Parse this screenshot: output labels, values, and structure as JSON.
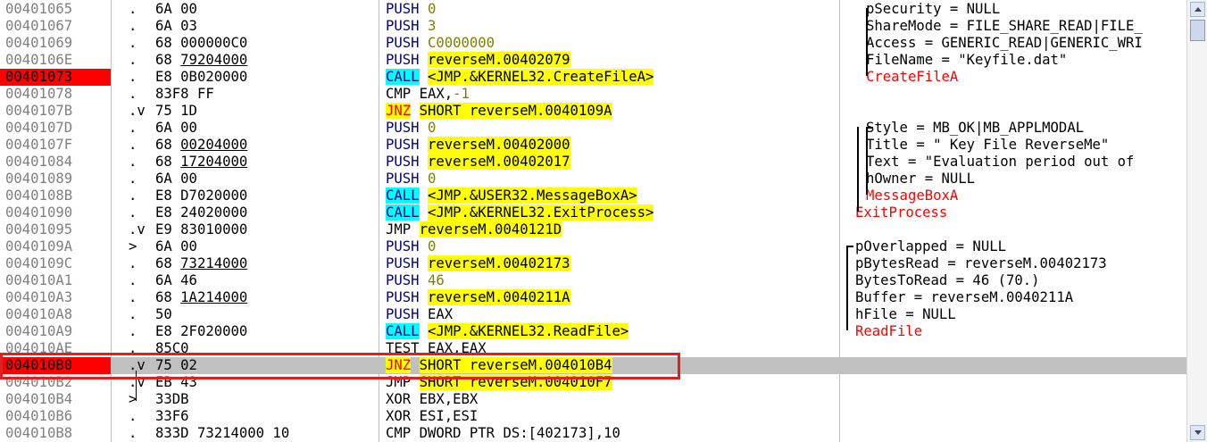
{
  "rows": [
    {
      "addr": "00401065",
      "mark": ".",
      "hex": [
        "6A 00"
      ],
      "mn": "PUSH",
      "op": "0",
      "cmt": "pSecurity = NULL"
    },
    {
      "addr": "00401067",
      "mark": ".",
      "hex": [
        "6A 03"
      ],
      "mn": "PUSH",
      "op": "3",
      "cmt": "ShareMode = FILE_SHARE_READ|FILE_"
    },
    {
      "addr": "00401069",
      "mark": ".",
      "hex": [
        "68 000000C0"
      ],
      "mn": "PUSH",
      "op": "C0000000",
      "cmt": "Access = GENERIC_READ|GENERIC_WRI"
    },
    {
      "addr": "0040106E",
      "mark": ".",
      "hex": [
        "68 ",
        "79204000"
      ],
      "mn": "PUSH",
      "op": "reverseM.00402079",
      "cmt": "FileName = \"Keyfile.dat\""
    },
    {
      "addr": "00401073",
      "mark": ".",
      "hex": [
        "E8 0B020000"
      ],
      "mn": "CALL",
      "op": "<JMP.&KERNEL32.CreateFileA>",
      "cmt": "CreateFileA"
    },
    {
      "addr": "00401078",
      "mark": ".",
      "hex": [
        "83F8 FF"
      ],
      "mn": "CMP",
      "op": "EAX,",
      "op2": "-1",
      "cmt": ""
    },
    {
      "addr": "0040107B",
      "mark": ".v",
      "hex": [
        "75 1D"
      ],
      "mn": "JNZ",
      "op": "SHORT reverseM.0040109A",
      "cmt": ""
    },
    {
      "addr": "0040107D",
      "mark": ".",
      "hex": [
        "6A 00"
      ],
      "mn": "PUSH",
      "op": "0",
      "cmt": "Style = MB_OK|MB_APPLMODAL"
    },
    {
      "addr": "0040107F",
      "mark": ".",
      "hex": [
        "68 ",
        "00204000"
      ],
      "mn": "PUSH",
      "op": "reverseM.00402000",
      "cmt": "Title = \" Key File ReverseMe\""
    },
    {
      "addr": "00401084",
      "mark": ".",
      "hex": [
        "68 ",
        "17204000"
      ],
      "mn": "PUSH",
      "op": "reverseM.00402017",
      "cmt": "Text = \"Evaluation period out of"
    },
    {
      "addr": "00401089",
      "mark": ".",
      "hex": [
        "6A 00"
      ],
      "mn": "PUSH",
      "op": "0",
      "cmt": "hOwner = NULL"
    },
    {
      "addr": "0040108B",
      "mark": ".",
      "hex": [
        "E8 D7020000"
      ],
      "mn": "CALL",
      "op": "<JMP.&USER32.MessageBoxA>",
      "cmt": "MessageBoxA"
    },
    {
      "addr": "00401090",
      "mark": ".",
      "hex": [
        "E8 24020000"
      ],
      "mn": "CALL",
      "op": "<JMP.&KERNEL32.ExitProcess>",
      "cmt": "ExitProcess"
    },
    {
      "addr": "00401095",
      "mark": ".v",
      "hex": [
        "E9 83010000"
      ],
      "mn": "JMP",
      "op": "reverseM.0040121D",
      "cmt": ""
    },
    {
      "addr": "0040109A",
      "mark": ">",
      "hex": [
        "6A 00"
      ],
      "mn": "PUSH",
      "op": "0",
      "cmt": "pOverlapped = NULL"
    },
    {
      "addr": "0040109C",
      "mark": ".",
      "hex": [
        "68 ",
        "73214000"
      ],
      "mn": "PUSH",
      "op": "reverseM.00402173",
      "cmt": "pBytesRead = reverseM.00402173"
    },
    {
      "addr": "004010A1",
      "mark": ".",
      "hex": [
        "6A 46"
      ],
      "mn": "PUSH",
      "op": "46",
      "cmt": "BytesToRead = 46 (70.)"
    },
    {
      "addr": "004010A3",
      "mark": ".",
      "hex": [
        "68 ",
        "1A214000"
      ],
      "mn": "PUSH",
      "op": "reverseM.0040211A",
      "cmt": "Buffer = reverseM.0040211A"
    },
    {
      "addr": "004010A8",
      "mark": ".",
      "hex": [
        "50"
      ],
      "mn": "PUSH",
      "op": "EAX",
      "cmt": "hFile = NULL"
    },
    {
      "addr": "004010A9",
      "mark": ".",
      "hex": [
        "E8 2F020000"
      ],
      "mn": "CALL",
      "op": "<JMP.&KERNEL32.ReadFile>",
      "cmt": "ReadFile"
    },
    {
      "addr": "004010AE",
      "mark": ".",
      "hex": [
        "85C0"
      ],
      "mn": "TEST",
      "op": "EAX,EAX",
      "cmt": ""
    },
    {
      "addr": "004010B0",
      "mark": ".v",
      "hex": [
        "75 02"
      ],
      "mn": "JNZ",
      "op": "SHORT reverseM.004010B4",
      "cmt": ""
    },
    {
      "addr": "004010B2",
      "mark": ".v",
      "hex": [
        "EB 43"
      ],
      "mn": "JMP",
      "op": "SHORT reverseM.004010F7",
      "cmt": ""
    },
    {
      "addr": "004010B4",
      "mark": ">",
      "hex": [
        "33DB"
      ],
      "mn": "XOR",
      "op": "EBX,EBX",
      "cmt": ""
    },
    {
      "addr": "004010B6",
      "mark": ".",
      "hex": [
        "33F6"
      ],
      "mn": "XOR",
      "op": "ESI,ESI",
      "cmt": ""
    },
    {
      "addr": "004010B8",
      "mark": ".",
      "hex": [
        "833D 73214000 10"
      ],
      "mn": "CMP",
      "op": "DWORD PTR DS:[402173],10",
      "cmt": ""
    }
  ],
  "colors": {
    "breakpoint": "#ff0000",
    "selection": "#c0c0c0",
    "call_bg": "#00ffff",
    "jump_bg": "#ffff00",
    "jump_fg": "#ff0000",
    "mnemonic": "#00008b",
    "immediate": "#808000",
    "highlight_box": "#e02020"
  },
  "breakpoints": [
    "00401073",
    "004010B0"
  ],
  "selected": "004010B0",
  "highlighted": "004010B0"
}
